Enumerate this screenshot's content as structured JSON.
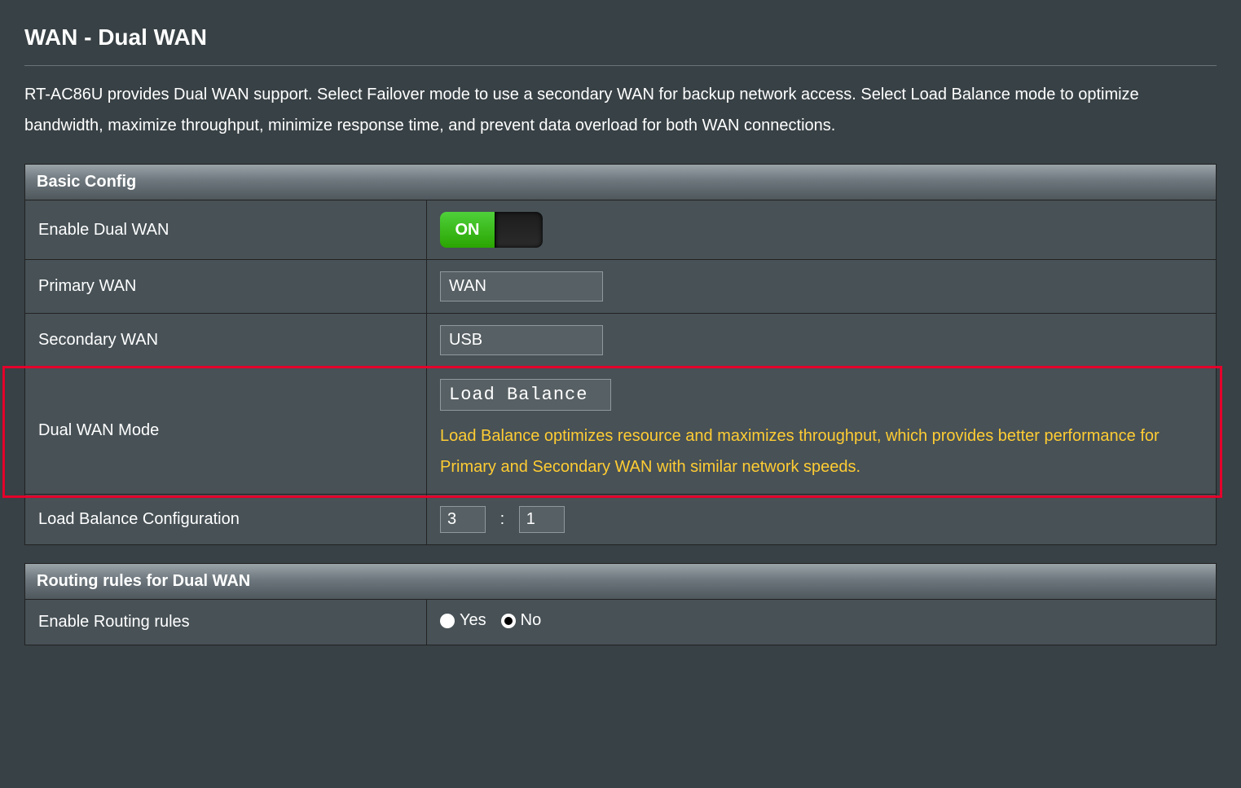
{
  "page": {
    "title": "WAN - Dual WAN",
    "description": "RT-AC86U provides Dual WAN support. Select Failover mode to use a secondary WAN for backup network access. Select Load Balance mode to optimize bandwidth, maximize throughput, minimize response time, and prevent data overload for both WAN connections."
  },
  "basic": {
    "header": "Basic Config",
    "enable_label": "Enable Dual WAN",
    "enable_state": "ON",
    "primary_label": "Primary WAN",
    "primary_value": "WAN",
    "secondary_label": "Secondary WAN",
    "secondary_value": "USB",
    "mode_label": "Dual WAN Mode",
    "mode_value": "Load Balance",
    "mode_hint": "Load Balance optimizes resource and maximizes throughput, which provides better performance for Primary and Secondary WAN with similar network speeds.",
    "lb_label": "Load Balance Configuration",
    "lb_a": "3",
    "lb_sep": ":",
    "lb_b": "1"
  },
  "routing": {
    "header": "Routing rules for Dual WAN",
    "enable_label": "Enable Routing rules",
    "yes": "Yes",
    "no": "No",
    "selected": "no"
  }
}
